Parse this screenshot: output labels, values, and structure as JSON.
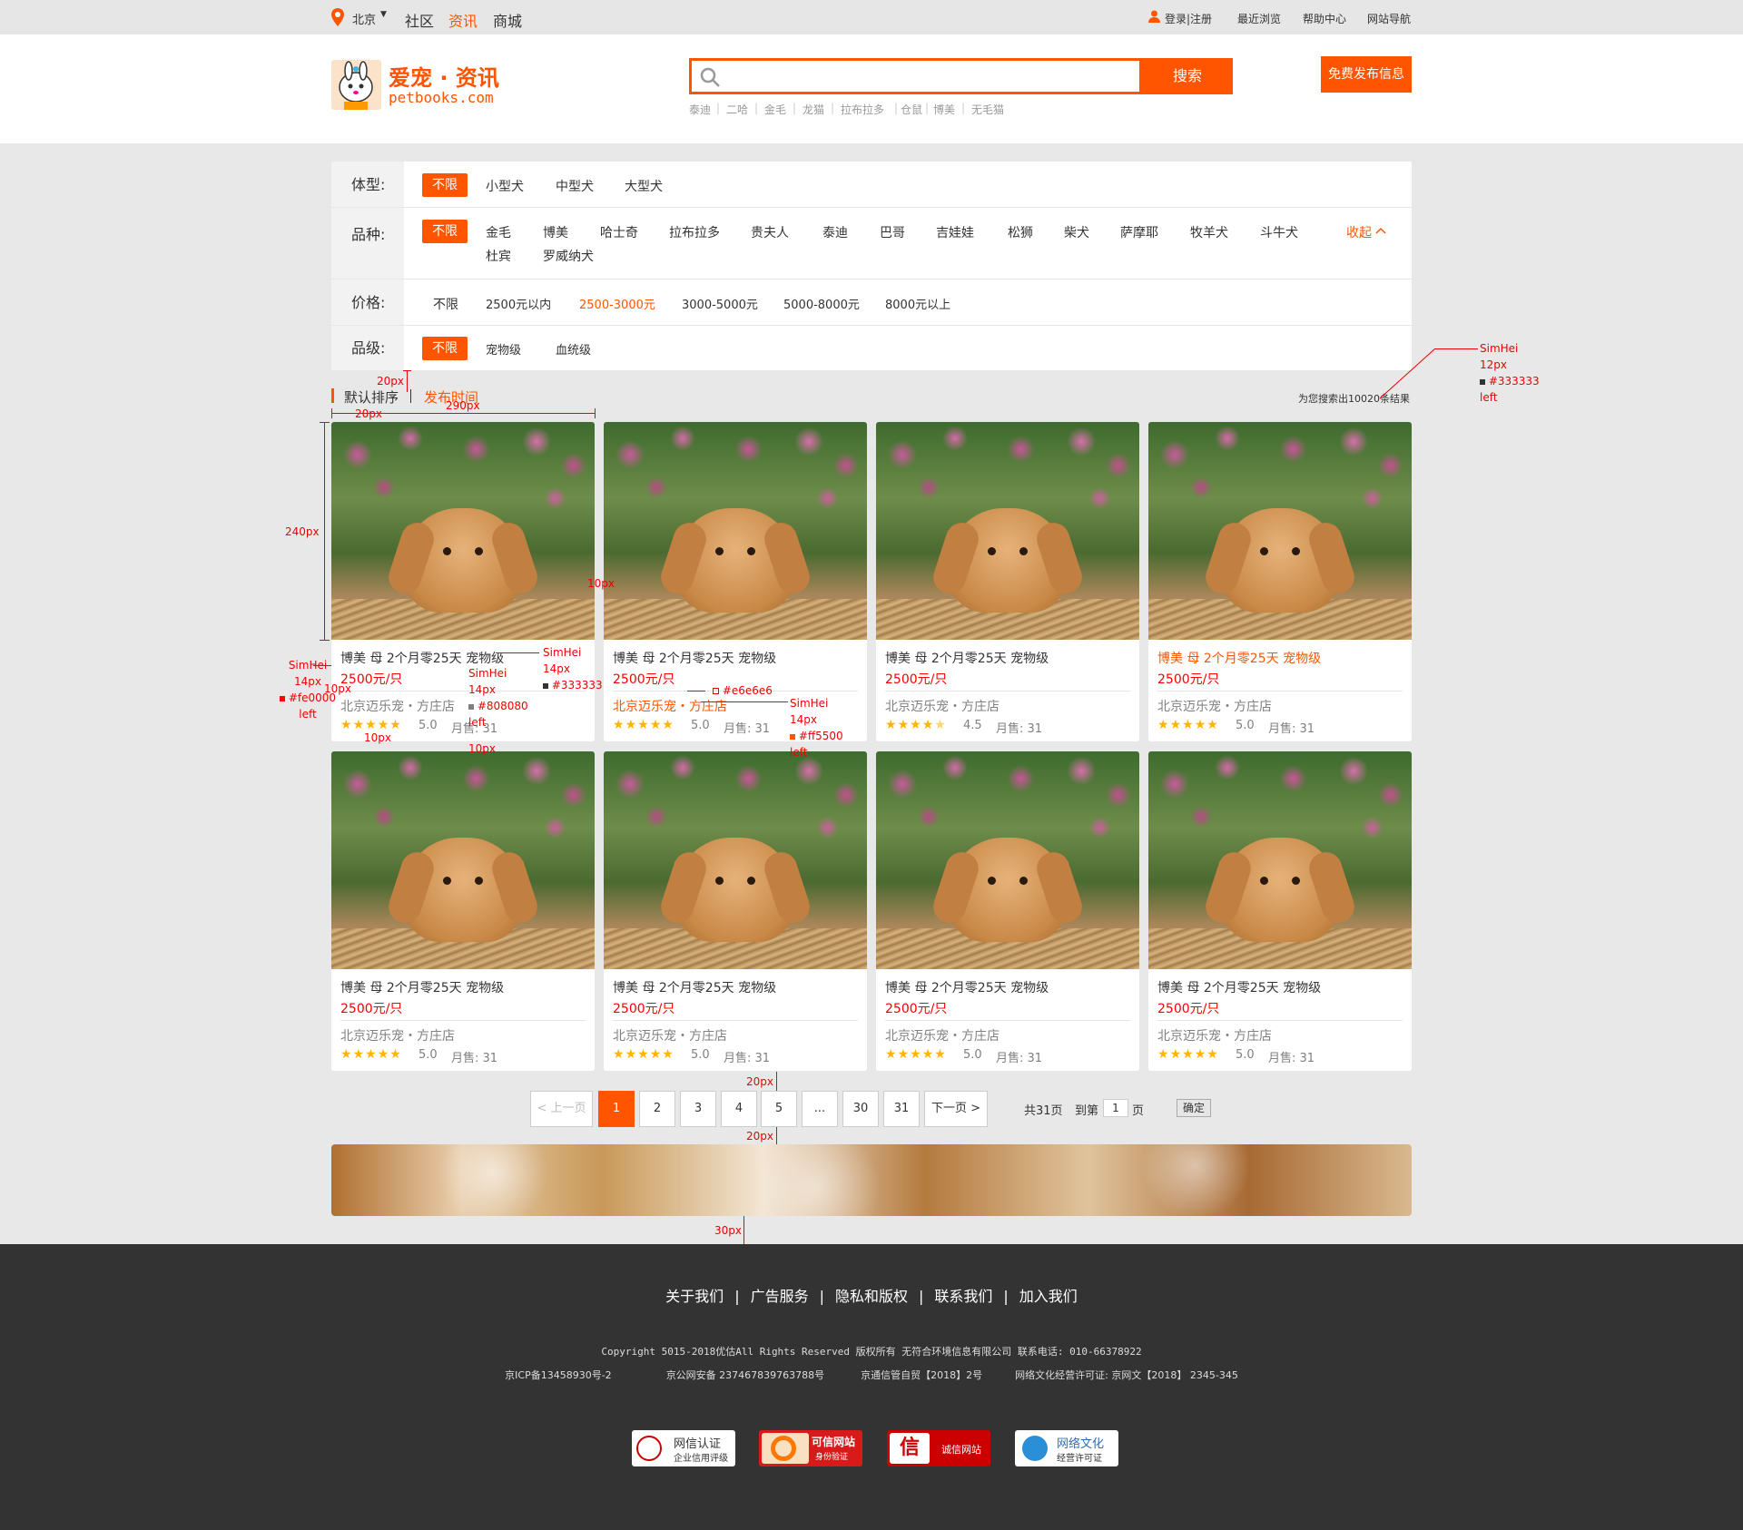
{
  "topbar": {
    "city": "北京",
    "nav": [
      "社区",
      "资讯",
      "商城"
    ],
    "login": "登录|注册",
    "links": [
      "最近浏览",
      "帮助中心",
      "网站导航"
    ]
  },
  "header": {
    "brand_cn": "爱宠 · 资讯",
    "brand_en": "petbooks.com",
    "search_placeholder": "",
    "search_button": "搜索",
    "publish_button": "免费发布信息",
    "hot_terms": [
      "泰迪",
      "二哈",
      "金毛",
      "龙猫",
      "拉布拉多",
      "仓鼠",
      "博美",
      "无毛猫"
    ]
  },
  "filter": {
    "size": {
      "label": "体型:",
      "options": [
        "不限",
        "小型犬",
        "中型犬",
        "大型犬"
      ]
    },
    "breed": {
      "label": "品种:",
      "options": [
        "不限",
        "金毛",
        "博美",
        "哈士奇",
        "拉布拉多",
        "贵夫人",
        "泰迪",
        "巴哥",
        "吉娃娃",
        "松狮",
        "柴犬",
        "萨摩耶",
        "牧羊犬",
        "斗牛犬",
        "杜宾",
        "罗威纳犬"
      ],
      "collapse": "收起"
    },
    "price": {
      "label": "价格:",
      "options": [
        "不限",
        "2500元以内",
        "2500-3000元",
        "3000-5000元",
        "5000-8000元",
        "8000元以上"
      ]
    },
    "grade": {
      "label": "品级:",
      "options": [
        "不限",
        "宠物级",
        "血统级"
      ]
    }
  },
  "sort": {
    "default": "默认排序",
    "time": "发布时间",
    "result": "为您搜索出10020条结果"
  },
  "cards": [
    {
      "title": "博美  母  2个月零25天  宠物级",
      "price": "2500元/只",
      "store": "北京迈乐宠・方庄店",
      "score": "5.0",
      "sales": "月售: 31",
      "stars": 5
    },
    {
      "title": "博美  母  2个月零25天  宠物级",
      "price": "2500元/只",
      "store": "北京迈乐宠・方庄店",
      "score": "5.0",
      "sales": "月售: 31",
      "stars": 5
    },
    {
      "title": "博美  母  2个月零25天  宠物级",
      "price": "2500元/只",
      "store": "北京迈乐宠・方庄店",
      "score": "4.5",
      "sales": "月售: 31",
      "stars": 4.5
    },
    {
      "title": "博美  母  2个月零25天  宠物级",
      "price": "2500元/只",
      "store": "北京迈乐宠・方庄店",
      "score": "5.0",
      "sales": "月售: 31",
      "stars": 5
    },
    {
      "title": "博美  母  2个月零25天  宠物级",
      "price": "2500元/只",
      "store": "北京迈乐宠・方庄店",
      "score": "5.0",
      "sales": "月售: 31",
      "stars": 5
    },
    {
      "title": "博美  母  2个月零25天  宠物级",
      "price": "2500元/只",
      "store": "北京迈乐宠・方庄店",
      "score": "5.0",
      "sales": "月售: 31",
      "stars": 5
    },
    {
      "title": "博美  母  2个月零25天  宠物级",
      "price": "2500元/只",
      "store": "北京迈乐宠・方庄店",
      "score": "5.0",
      "sales": "月售: 31",
      "stars": 5
    },
    {
      "title": "博美  母  2个月零25天  宠物级",
      "price": "2500元/只",
      "store": "北京迈乐宠・方庄店",
      "score": "5.0",
      "sales": "月售: 31",
      "stars": 5
    }
  ],
  "pagination": {
    "prev": "< 上一页",
    "pages": [
      "1",
      "2",
      "3",
      "4",
      "5",
      "...",
      "30",
      "31"
    ],
    "next": "下一页 >",
    "total": "共31页",
    "goto": "到第",
    "goto_value": "1",
    "page_unit": "页",
    "confirm": "确定"
  },
  "footer": {
    "links": [
      "关于我们",
      "广告服务",
      "隐私和版权",
      "联系我们",
      "加入我们"
    ],
    "copyright": "Copyright  5015-2018优估All Rights Reserved 版权所有  无符合环境信息有限公司   联系电话: 010-66378922",
    "icp": [
      "京ICP备13458930号-2",
      "京公网安备 237467839763788号",
      "京通信管自贸【2018】2号",
      "网络文化经营许可证: 京网文【2018】 2345-345"
    ],
    "badges": [
      {
        "title": "网信认证",
        "sub": "企业信用评级"
      },
      {
        "title": "可信网站",
        "sub": "身份验证"
      },
      {
        "title": "诚信网站",
        "sub": ""
      },
      {
        "title": "网络文化",
        "sub": "经营许可证"
      }
    ]
  },
  "annotations": {
    "result_font": [
      "SimHei",
      "12px",
      "#333333",
      "left"
    ],
    "title_font": [
      "SimHei",
      "14px",
      "#333333"
    ],
    "price_font": [
      "SimHei",
      "14px",
      "#fe0000",
      "left"
    ],
    "store_font": [
      "SimHei",
      "14px",
      "#808080",
      "left"
    ],
    "store_hover_font": [
      "SimHei",
      "14px",
      "#ff5500",
      "left"
    ],
    "divider_color": "#e6e6e6",
    "spacing": [
      "20px",
      "20px",
      "290px",
      "240px",
      "10px",
      "10px",
      "10px",
      "10px",
      "20px",
      "20px",
      "30px"
    ]
  },
  "colors": {
    "accent": "#ff5500",
    "price": "#fe0000",
    "footer_bg": "#333333"
  }
}
